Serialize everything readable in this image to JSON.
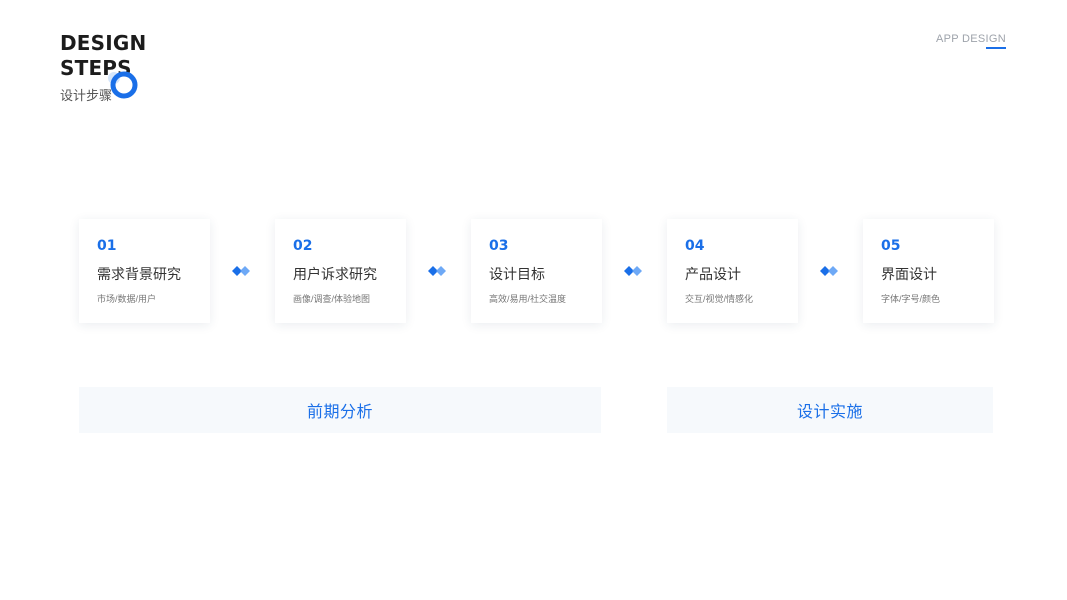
{
  "header": {
    "title_line1": "DESIGN",
    "title_line2": "STEPS",
    "subtitle_cn": "设计步骤",
    "top_right_label": "APP DESIGN"
  },
  "steps": [
    {
      "num": "01",
      "title": "需求背景研究",
      "tags": "市场/数据/用户"
    },
    {
      "num": "02",
      "title": "用户诉求研究",
      "tags": "画像/调查/体验地图"
    },
    {
      "num": "03",
      "title": "设计目标",
      "tags": "高效/易用/社交温度"
    },
    {
      "num": "04",
      "title": "产品设计",
      "tags": "交互/视觉/情感化"
    },
    {
      "num": "05",
      "title": "界面设计",
      "tags": "字体/字号/颜色"
    }
  ],
  "phases": [
    {
      "label": "前期分析"
    },
    {
      "label": "设计实施"
    }
  ],
  "colors": {
    "accent": "#1a6fe8",
    "accent_light": "#5ea0f5",
    "phase_bg": "#f6f9fc"
  },
  "icons": {
    "decoration": "ring-icon",
    "connector": "double-diamond-arrow-icon"
  }
}
